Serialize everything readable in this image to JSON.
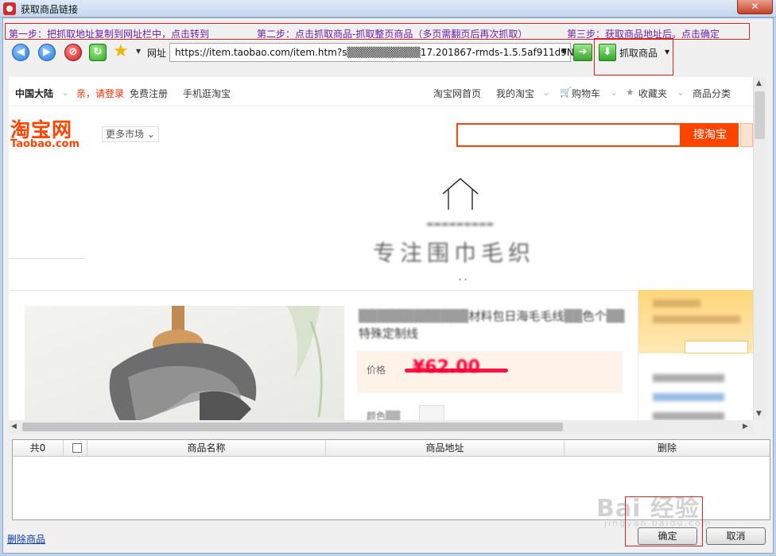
{
  "window": {
    "title": "获取商品链接",
    "close_symbol": "✕"
  },
  "instructions": {
    "step1": "第一步：把抓取地址复制到网址栏中，点击转到",
    "step2": "第二步：点击抓取商品-抓取整页商品（多页需翻页后再次抓取）",
    "step3": "第三步：获取商品地址后。点击确定"
  },
  "toolbar": {
    "address_label": "网址",
    "address_value": "https://item.taobao.com/item.htm?s▒▒▒▒▒▒▒▒▒▒17.201867-rmds-1.5.5af911d9Ng",
    "grab_label": "抓取商品",
    "icons": [
      "back-icon",
      "forward-icon",
      "stop-icon",
      "refresh-icon",
      "favorite-star-icon",
      "go-arrow-icon",
      "download-icon"
    ]
  },
  "site": {
    "region": "中国大陆",
    "login": "亲，请登录",
    "register": "免费注册",
    "mobile": "手机逛淘宝",
    "nav": [
      "淘宝网首页",
      "我的淘宝",
      "购物车",
      "收藏夹",
      "商品分类"
    ],
    "logo_cn": "淘宝网",
    "logo_en": "Taobao.com",
    "more_market": "更多市场",
    "search_button": "搜淘宝",
    "shop_title": "专注围巾毛织",
    "product_name": "▒▒▒▒▒▒▒▒▒▒▒▒材料包日海毛毛线▒▒色个▒▒特殊定制线",
    "price_label": "价格",
    "price_value": "¥62.00",
    "color_label": "颜色▒▒"
  },
  "grid": {
    "count_label": "共0",
    "columns": [
      "商品名称",
      "商品地址",
      "删除"
    ]
  },
  "footer": {
    "delete_goods": "删除商品",
    "ok": "确定",
    "cancel": "取消",
    "watermark": "Bai 经验",
    "watermark_sub": "jingyan.baidu.com"
  },
  "colors": {
    "accent": "#ff4400",
    "annotation": "#e02020",
    "instruction_text": "#6b1fa8"
  }
}
